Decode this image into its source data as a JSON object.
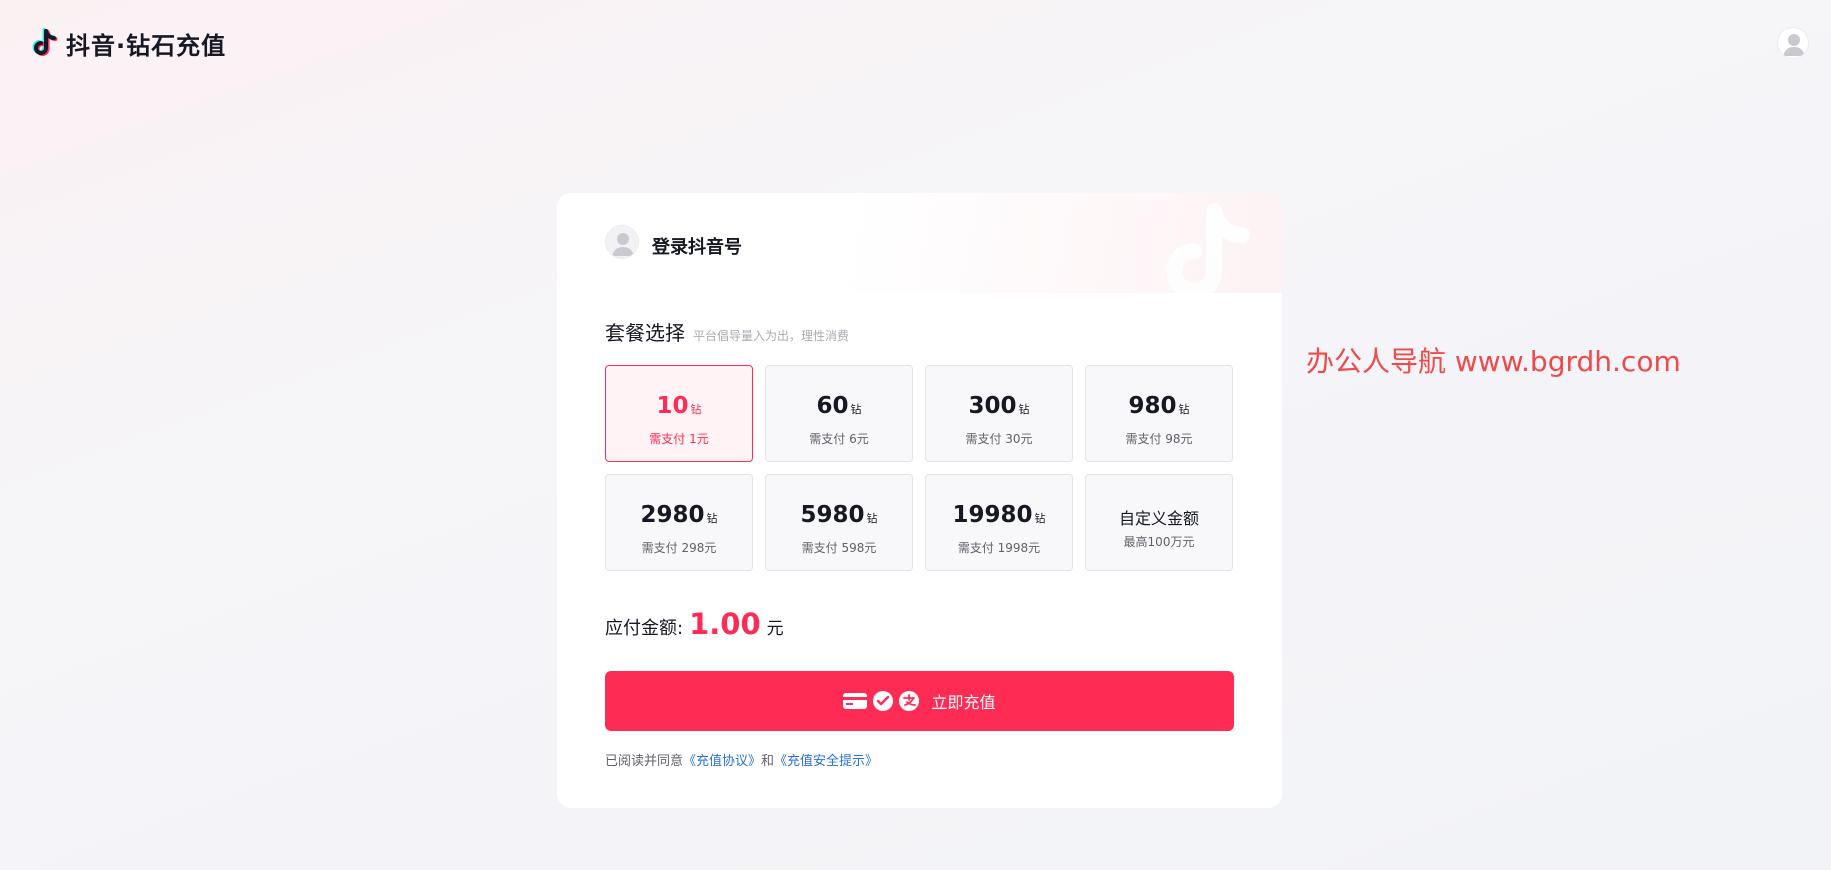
{
  "header": {
    "logo_text": "抖音·钻石充值",
    "logo_icon": "douyin-note-icon",
    "avatar_icon": "user-avatar-icon"
  },
  "card": {
    "login_text": "登录抖音号",
    "section_title": "套餐选择",
    "section_hint": "平台倡导量入为出，理性消费",
    "unit": "钻",
    "packages": [
      {
        "amount": "10",
        "price": "需支付 1元",
        "selected": true
      },
      {
        "amount": "60",
        "price": "需支付 6元"
      },
      {
        "amount": "300",
        "price": "需支付 30元"
      },
      {
        "amount": "980",
        "price": "需支付 98元"
      },
      {
        "amount": "2980",
        "price": "需支付 298元"
      },
      {
        "amount": "5980",
        "price": "需支付 598元"
      },
      {
        "amount": "19980",
        "price": "需支付 1998元"
      }
    ],
    "custom": {
      "title": "自定义金额",
      "subtitle": "最高100万元"
    },
    "total_label": "应付金额:",
    "total_value": "1.00",
    "total_currency": "元",
    "pay_button_label": "立即充值",
    "pay_icons": [
      "bank-card-icon",
      "wechat-pay-icon",
      "alipay-icon"
    ],
    "agreement": {
      "prefix": "已阅读并同意",
      "link1": "《充值协议》",
      "middle": "和",
      "link2": "《充值安全提示》"
    }
  },
  "watermark_text": "办公人导航 www.bgrdh.com",
  "colors": {
    "accent": "#fe2c55",
    "link": "#2a70e0",
    "watermark": "#ef4a4a"
  }
}
